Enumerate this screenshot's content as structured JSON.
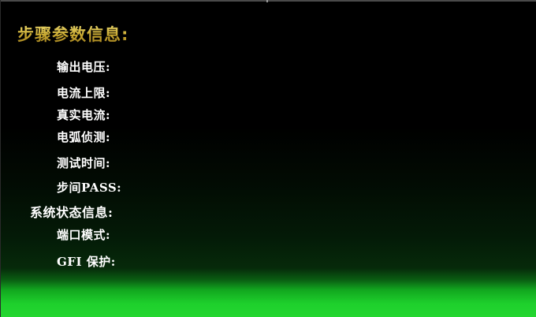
{
  "step_params": {
    "title": "步骤参数信息:",
    "fields": {
      "output_voltage": "输出电压:",
      "current_upper_limit": "电流上限:",
      "real_current": "真实电流:",
      "arc_detection": "电弧侦测:",
      "test_time": "测试时间:",
      "step_pass": "步间PASS:"
    }
  },
  "system_status": {
    "title": "系统状态信息:",
    "fields": {
      "port_mode": "端口模式:",
      "gfi_protection": "GFI 保护:"
    }
  },
  "colors": {
    "background": "#000000",
    "label_text": "#ffffff",
    "title_gold": "#d8c24a",
    "bottom_green": "#24d630"
  }
}
